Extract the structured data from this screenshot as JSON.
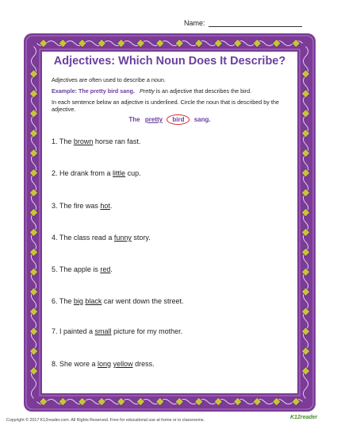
{
  "header": {
    "name_label": "Name:"
  },
  "worksheet": {
    "title": "Adjectives: Which Noun Does It Describe?",
    "intro": "Adjectives are often used to describe a noun.",
    "example": {
      "label": "Example: The pretty bird sang.",
      "italic_word": "Pretty",
      "rest": "is an adjective that describes the bird."
    },
    "instructions": "In each sentence below an adjective is underlined. Circle the noun that is described by the adjective.",
    "demo": {
      "w1": "The",
      "w2": "pretty",
      "w3": "bird",
      "w4": "sang."
    },
    "sentences": [
      {
        "pre": "1. The ",
        "u": "brown",
        "post": " horse ran fast."
      },
      {
        "pre": "2. He drank from a ",
        "u": "little",
        "post": " cup."
      },
      {
        "pre": "3. The fire was ",
        "u": "hot",
        "post": "."
      },
      {
        "pre": "4. The class read a ",
        "u": "funny",
        "post": " story."
      },
      {
        "pre": "5. The apple is ",
        "u": "red",
        "post": "."
      },
      {
        "pre": "6. The ",
        "u": "big",
        "mid": " ",
        "u2": "black",
        "post": " car went down the street."
      },
      {
        "pre": "7. I painted a ",
        "u": "small",
        "post": " picture for my mother."
      },
      {
        "pre": "8. She wore a ",
        "u": "long",
        "mid": " ",
        "u2": "yellow",
        "post": " dress."
      }
    ]
  },
  "footer": {
    "copyright": "Copyright © 2017  K12reader.com. All Rights Reserved. Free for educational use at home or in classrooms.",
    "logo": "K12reader"
  },
  "colors": {
    "border": "#7b3b97",
    "diamond": "#c8c43a",
    "title": "#6b3fa0",
    "circle": "#d62a2a"
  }
}
